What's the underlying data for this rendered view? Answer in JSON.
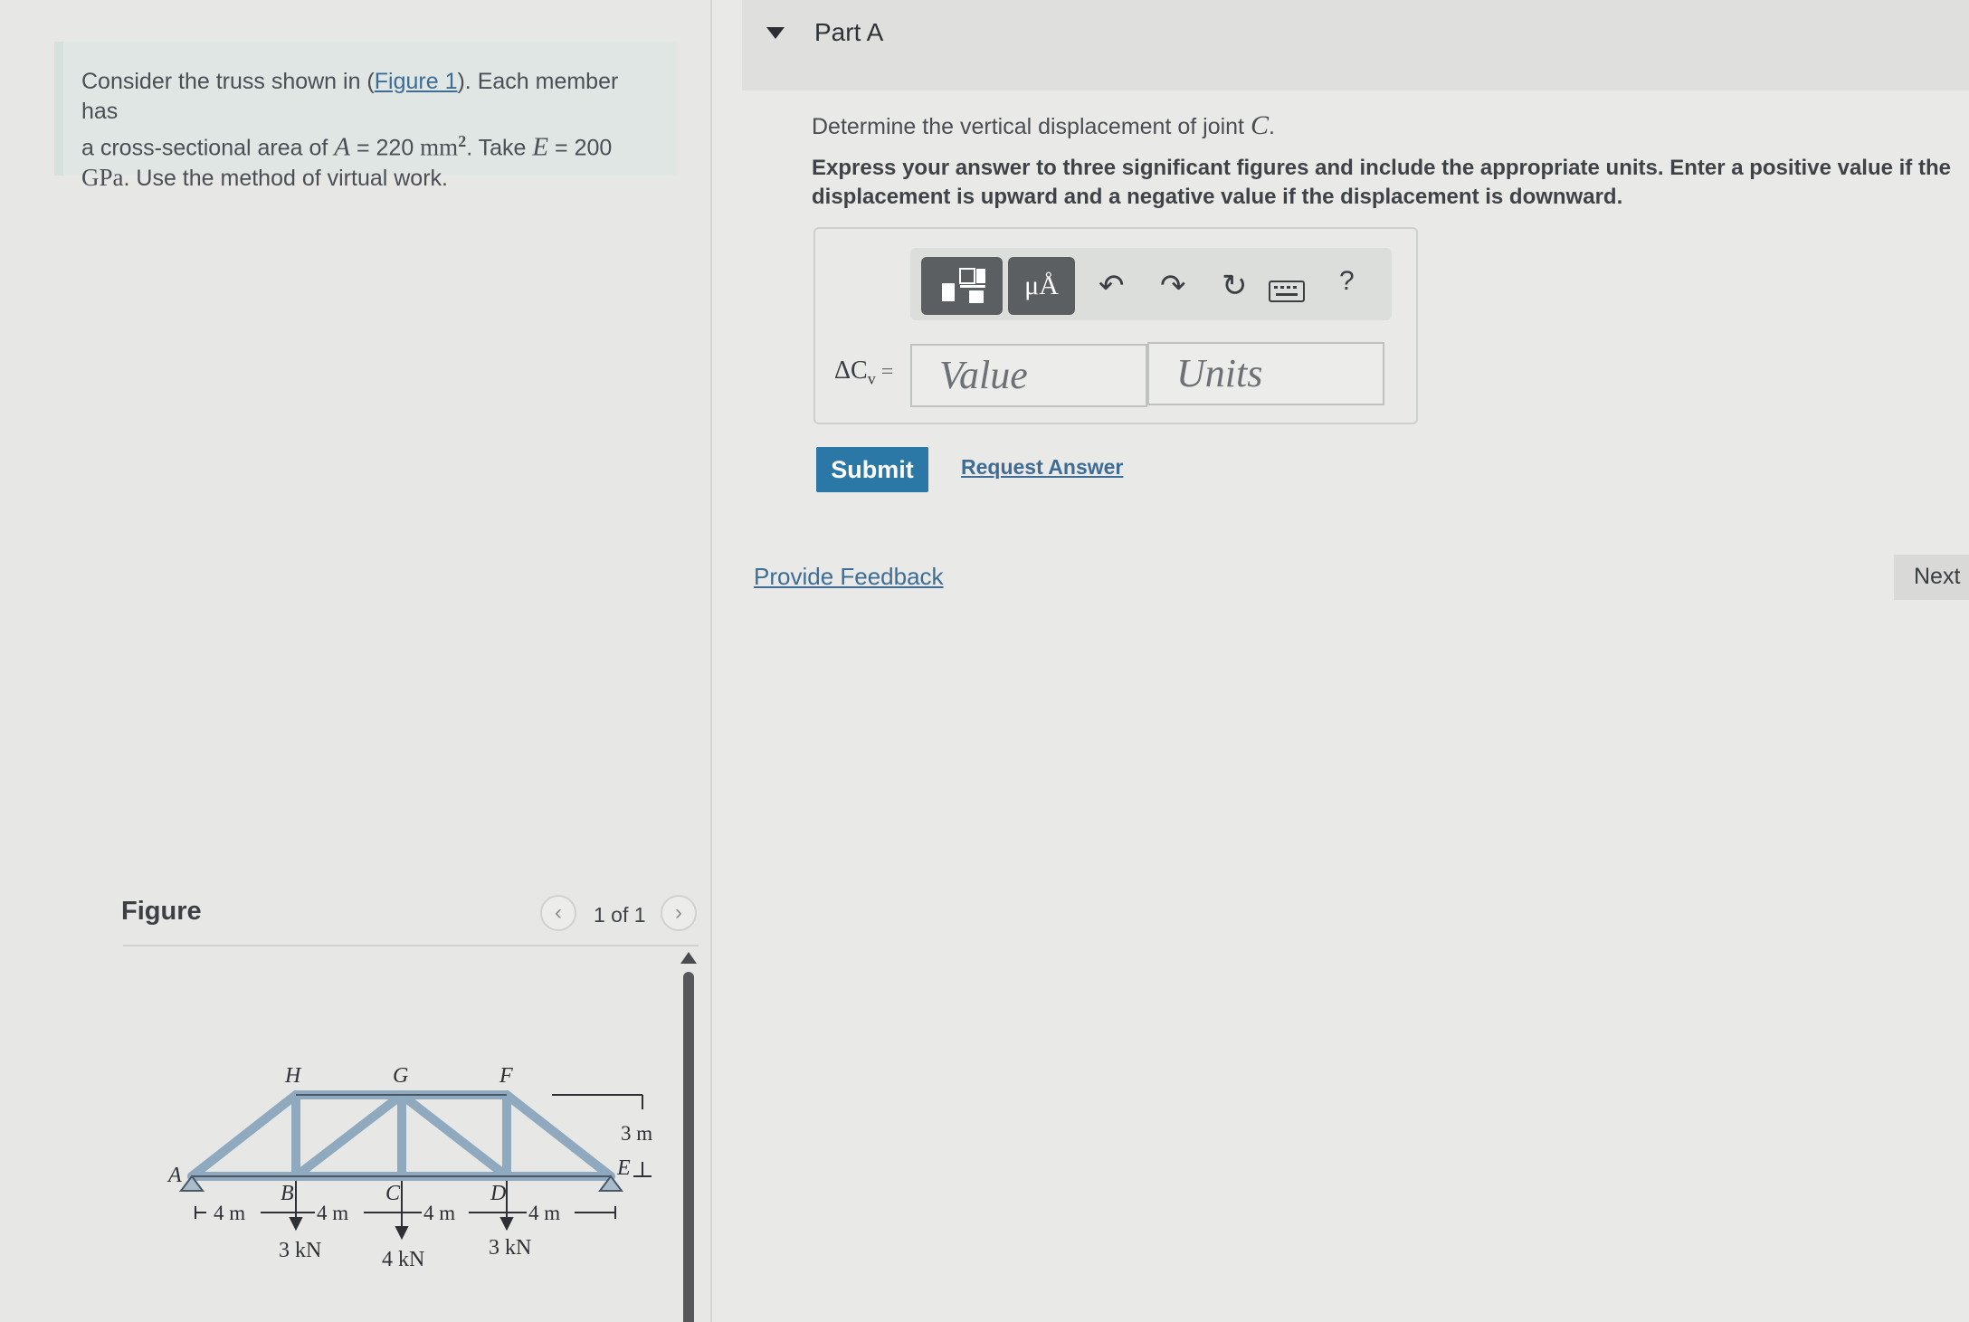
{
  "problem": {
    "text_before_link": "Consider the truss shown in (",
    "figure_link": "Figure 1",
    "text_after_link": "). Each member has",
    "line2_prefix": "a cross-sectional area of ",
    "area_symbol": "A",
    "area_value": " = 220 ",
    "area_unit": "mm",
    "area_exp": "2",
    "line2_mid": ". Take ",
    "modulus_symbol": "E",
    "modulus_value": " = 200",
    "line3_unit": "GPa",
    "line3_rest": ". Use the method of virtual work."
  },
  "figure": {
    "label": "Figure",
    "pager": "1 of 1",
    "prev_icon": "chevron-left-icon",
    "next_icon": "chevron-right-icon",
    "joints": [
      "A",
      "B",
      "C",
      "D",
      "E",
      "F",
      "G",
      "H"
    ],
    "loads": [
      "3 kN",
      "4 kN",
      "3 kN"
    ],
    "spans": [
      "4 m",
      "4 m",
      "4 m",
      "4 m"
    ],
    "height": "3 m"
  },
  "part": {
    "title": "Part A",
    "question_prefix": "Determine the vertical displacement of joint ",
    "question_joint": "C",
    "question_suffix": ".",
    "instructions": "Express your answer to three significant figures and include the appropriate units. Enter a positive value if the displacement is upward and a negative value if the displacement is downward.",
    "answer_label": "ΔC",
    "answer_label_sub": "v",
    "answer_label_eq": " =",
    "value_placeholder": "Value",
    "units_placeholder": "Units",
    "toolbar": {
      "templates_icon": "templates-icon",
      "units_button": "μÅ",
      "undo_icon": "undo-icon",
      "redo_icon": "redo-icon",
      "reset_icon": "reset-icon",
      "keyboard_icon": "keyboard-icon",
      "help": "?"
    },
    "submit": "Submit",
    "request_answer": "Request Answer"
  },
  "footer": {
    "feedback": "Provide Feedback",
    "next": "Next"
  }
}
